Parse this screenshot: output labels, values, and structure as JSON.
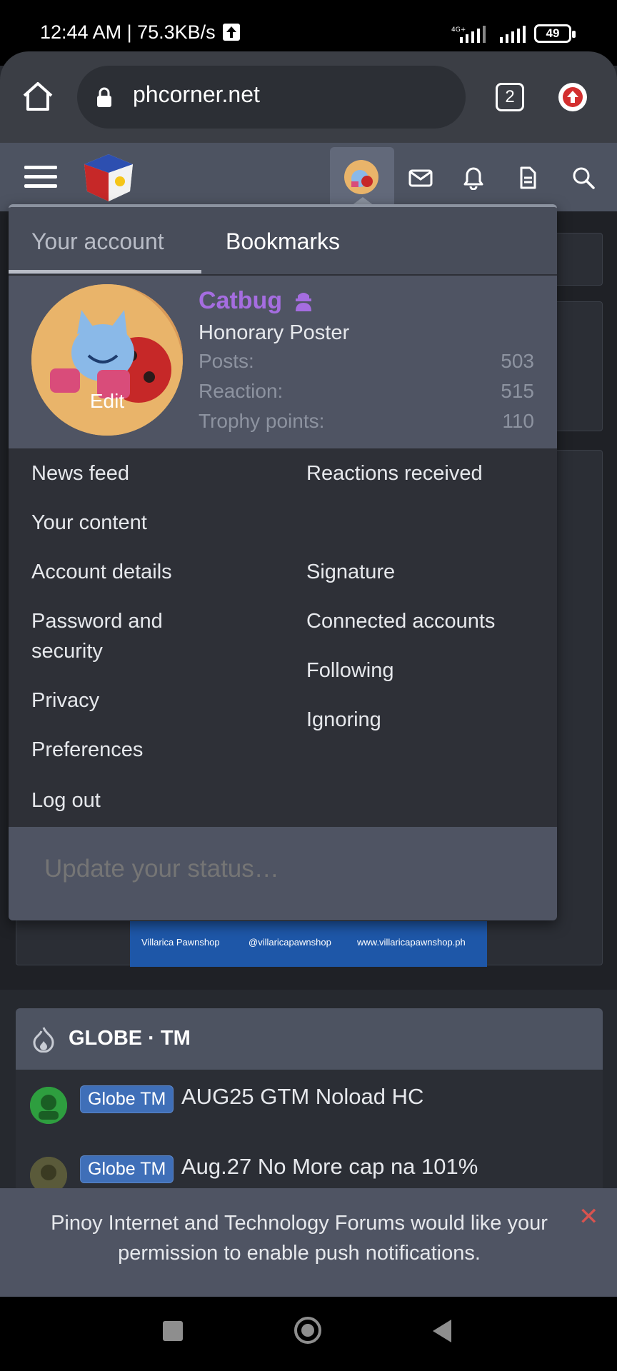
{
  "status_bar": {
    "time_speed": "12:44 AM | 75.3KB/s",
    "network": "4G+",
    "battery": "49"
  },
  "browser": {
    "url": "phcorner.net",
    "tab_count": "2"
  },
  "dropdown": {
    "tabs": [
      "Your account",
      "Bookmarks"
    ],
    "profile": {
      "username": "Catbug",
      "title": "Honorary Poster",
      "edit_label": "Edit",
      "stats": [
        {
          "label": "Posts:",
          "value": "503"
        },
        {
          "label": "Reaction:",
          "value": "515"
        },
        {
          "label": "Trophy points:",
          "value": "110"
        }
      ]
    },
    "menu_left": [
      "News feed",
      "Your content",
      "Account details",
      "Password and\nsecurity",
      "Privacy",
      "Preferences",
      "Log out"
    ],
    "menu_right": [
      "Reactions received",
      "Signature",
      "Connected accounts",
      "Following",
      "Ignoring"
    ],
    "status_placeholder": "Update your status…"
  },
  "banner": {
    "facebook": "Villarica Pawnshop",
    "instagram": "@villaricapawnshop",
    "website": "www.villaricapawnshop.ph"
  },
  "section": {
    "title": "GLOBE · TM",
    "threads": [
      {
        "prefix": "Globe TM",
        "title": "AUG25 GTM Noload HC"
      },
      {
        "prefix": "Globe TM",
        "title": "Aug.27 No More cap na 101%"
      }
    ]
  },
  "push_notification": {
    "text": "Pinoy Internet and Technology Forums would like your permission to enable push notifications.",
    "close": "✕"
  },
  "colors": {
    "username": "#a56de0",
    "prefix_bg": "#3f6fb8",
    "close": "#d9534f"
  }
}
